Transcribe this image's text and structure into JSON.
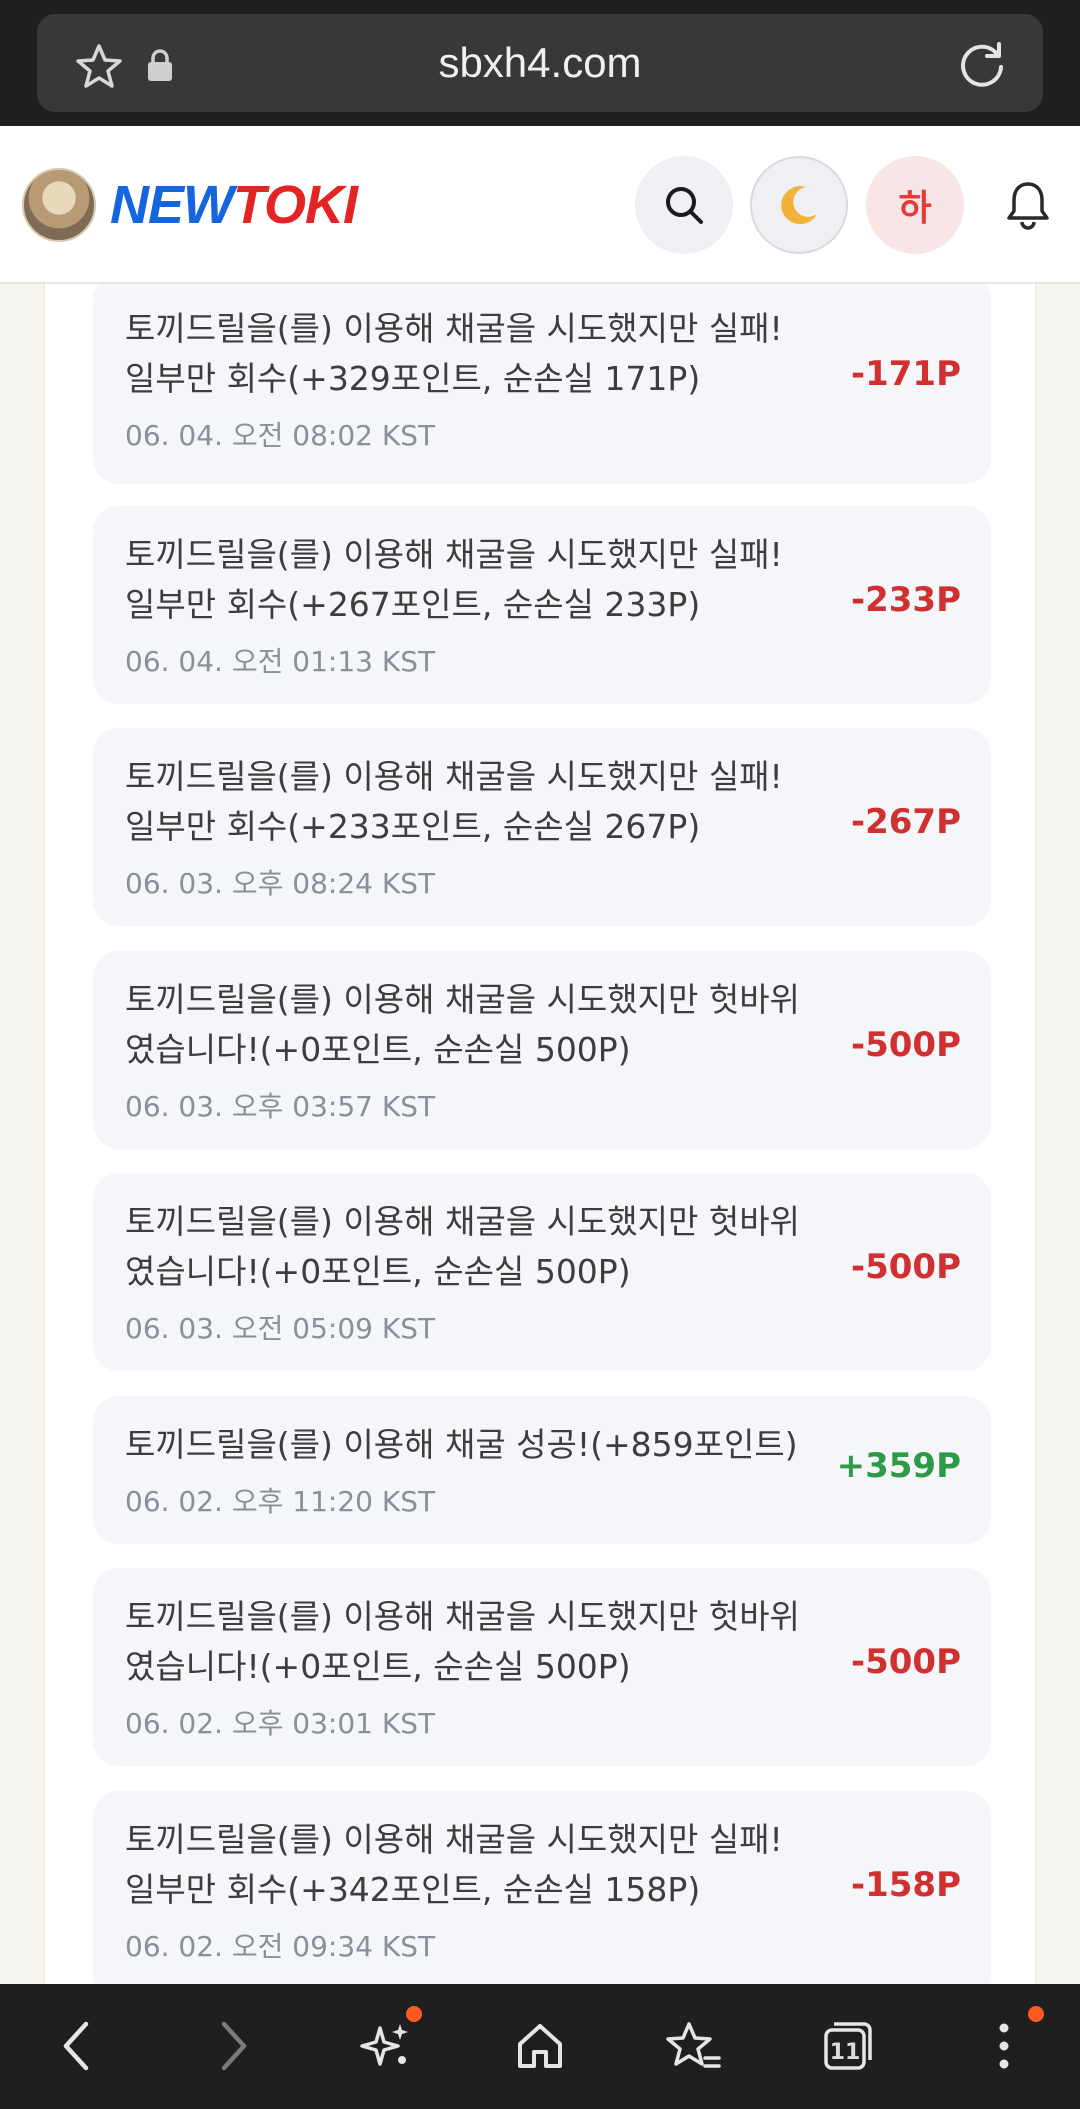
{
  "browser": {
    "url": "sbxh4.com",
    "tab_count": "11"
  },
  "site": {
    "logo_new": "NEW",
    "logo_toki": "TOKI",
    "lang_button": "하"
  },
  "history": [
    {
      "line1": "토끼드릴을(를) 이용해 채굴을 시도했지만 실패!",
      "line2": "일부만 회수(+329포인트, 순손실 171P)",
      "date": "06. 04. 오전 08:02 KST",
      "amount": "-171P",
      "kind": "neg"
    },
    {
      "line1": "토끼드릴을(를) 이용해 채굴을 시도했지만 실패!",
      "line2": "일부만 회수(+267포인트, 순손실 233P)",
      "date": "06. 04. 오전 01:13 KST",
      "amount": "-233P",
      "kind": "neg"
    },
    {
      "line1": "토끼드릴을(를) 이용해 채굴을 시도했지만 실패!",
      "line2": "일부만 회수(+233포인트, 순손실 267P)",
      "date": "06. 03. 오후 08:24 KST",
      "amount": "-267P",
      "kind": "neg"
    },
    {
      "line1": "토끼드릴을(를) 이용해 채굴을 시도했지만 헛바위",
      "line2": "였습니다!(+0포인트, 순손실 500P)",
      "date": "06. 03. 오후 03:57 KST",
      "amount": "-500P",
      "kind": "neg"
    },
    {
      "line1": "토끼드릴을(를) 이용해 채굴을 시도했지만 헛바위",
      "line2": "였습니다!(+0포인트, 순손실 500P)",
      "date": "06. 03. 오전 05:09 KST",
      "amount": "-500P",
      "kind": "neg"
    },
    {
      "line1": "토끼드릴을(를) 이용해 채굴 성공!(+859포인트)",
      "line2": "",
      "date": "06. 02. 오후 11:20 KST",
      "amount": "+359P",
      "kind": "pos"
    },
    {
      "line1": "토끼드릴을(를) 이용해 채굴을 시도했지만 헛바위",
      "line2": "였습니다!(+0포인트, 순손실 500P)",
      "date": "06. 02. 오후 03:01 KST",
      "amount": "-500P",
      "kind": "neg"
    },
    {
      "line1": "토끼드릴을(를) 이용해 채굴을 시도했지만 실패!",
      "line2": "일부만 회수(+342포인트, 순손실 158P)",
      "date": "06. 02. 오전 09:34 KST",
      "amount": "-158P",
      "kind": "neg"
    }
  ],
  "colors": {
    "negative": "#d03030",
    "positive": "#2e9a45",
    "logo_blue": "#1565e0",
    "logo_red": "#e42422"
  },
  "icons": {
    "top": [
      "star-icon",
      "lock-icon",
      "reload-icon"
    ],
    "header": [
      "search-icon",
      "moon-icon",
      "bell-icon"
    ],
    "bottom": [
      "back-icon",
      "forward-icon",
      "sparkle-icon",
      "home-icon",
      "bookmarks-icon",
      "tabs-icon",
      "more-icon"
    ]
  }
}
